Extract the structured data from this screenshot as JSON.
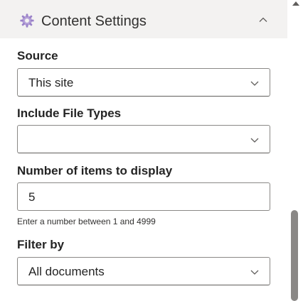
{
  "header": {
    "title": "Content Settings",
    "icon": "gear-icon",
    "collapse_icon": "chevron-up-icon"
  },
  "fields": {
    "source": {
      "label": "Source",
      "value": "This site"
    },
    "file_types": {
      "label": "Include File Types",
      "value": ""
    },
    "items_count": {
      "label": "Number of items to display",
      "value": "5",
      "hint": "Enter a number between 1 and 4999"
    },
    "filter": {
      "label": "Filter by",
      "value": "All documents"
    }
  },
  "colors": {
    "header_bg": "#f3f2f1",
    "border": "#8a8886",
    "gear_accent": "#8764b8",
    "scroll_thumb": "#8a8886"
  }
}
